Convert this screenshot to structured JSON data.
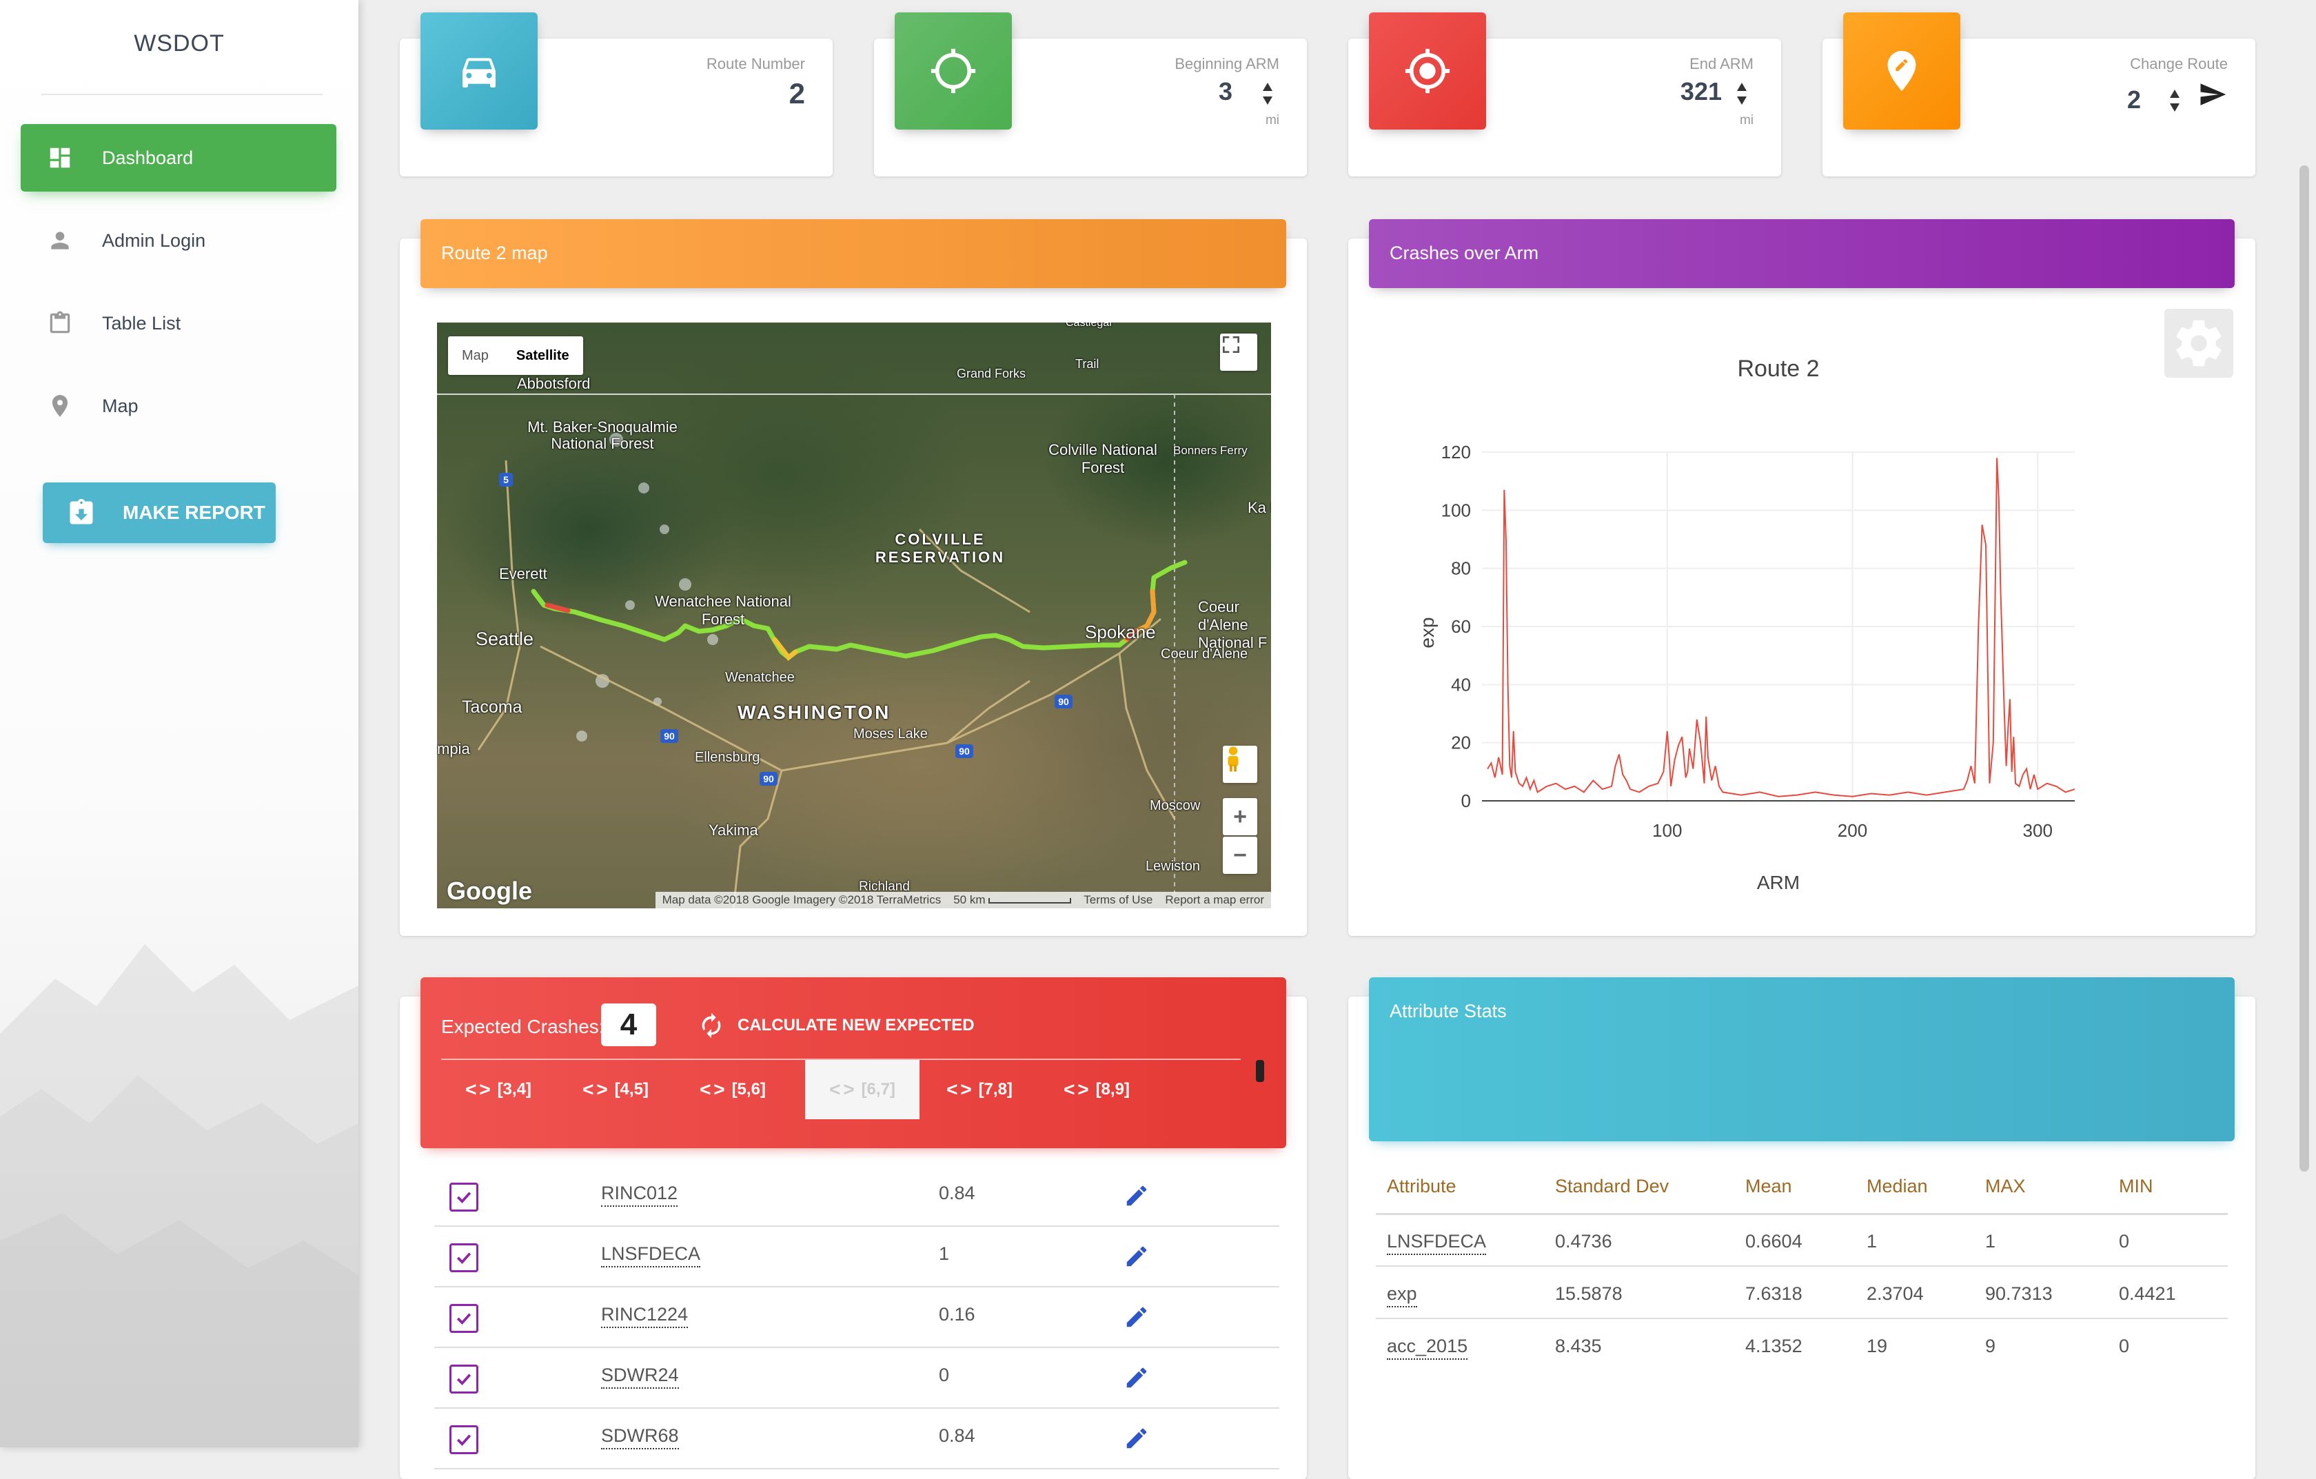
{
  "sidebar": {
    "brand": "WSDOT",
    "items": [
      {
        "label": "Dashboard",
        "icon": "dashboard-icon",
        "active": true
      },
      {
        "label": "Admin Login",
        "icon": "person-icon",
        "active": false
      },
      {
        "label": "Table List",
        "icon": "clipboard-icon",
        "active": false
      },
      {
        "label": "Map",
        "icon": "location-pin-icon",
        "active": false
      }
    ],
    "report_button": "MAKE REPORT"
  },
  "stats": {
    "route": {
      "category": "Route Number",
      "value": "2",
      "color": "#4fb6cd"
    },
    "begin": {
      "category": "Beginning ARM",
      "value": "3",
      "unit": "mi",
      "color": "#5cb85c"
    },
    "end": {
      "category": "End ARM",
      "value": "321",
      "unit": "mi",
      "color": "#e53935"
    },
    "change": {
      "category": "Change Route",
      "value": "2",
      "color": "#f0a33a"
    }
  },
  "map_panel": {
    "title": "Route 2 map",
    "toggle": {
      "map": "Map",
      "satellite": "Satellite"
    },
    "labels": {
      "abbotsford": "Abbotsford",
      "grand_forks": "Grand Forks",
      "trail": "Trail",
      "castlegar": "Castlegar",
      "bonners_ferry": "Bonners Ferry",
      "mt_baker": "Mt. Baker-Snoqualmie National Forest",
      "colville_nf": "Colville National Forest",
      "colville_res": "COLVILLE RESERVATION",
      "everett": "Everett",
      "seattle": "Seattle",
      "tacoma": "Tacoma",
      "wenatchee_nf": "Wenatchee National Forest",
      "wenatchee": "Wenatchee",
      "washington": "WASHINGTON",
      "moses_lake": "Moses Lake",
      "ellensburg": "Ellensburg",
      "yakima": "Yakima",
      "spokane": "Spokane",
      "coeur_nf": "Coeur d'Alene National F",
      "coeur": "Coeur d'Alene",
      "moscow": "Moscow",
      "lewiston": "Lewiston",
      "richland": "Richland",
      "olympia": "mpia",
      "ka_nation": "Ka Nation"
    },
    "highway_shields": [
      "5",
      "90",
      "90",
      "90",
      "90"
    ],
    "google": "Google",
    "attribution": {
      "data": "Map data ©2018 Google Imagery ©2018 TerraMetrics",
      "scale": "50 km",
      "terms": "Terms of Use",
      "report": "Report a map error"
    },
    "zoom_in": "+",
    "zoom_out": "−"
  },
  "chart_panel": {
    "title": "Crashes over Arm"
  },
  "chart_data": {
    "type": "line",
    "title": "Route 2",
    "xlabel": "ARM",
    "ylabel": "exp",
    "xlim": [
      0,
      320
    ],
    "ylim": [
      0,
      120
    ],
    "xticks": [
      100,
      200,
      300
    ],
    "yticks": [
      0,
      20,
      40,
      60,
      80,
      100,
      120
    ],
    "series": [
      {
        "color": "#e8493c",
        "x": [
          3,
          5,
          7,
          9,
          11,
          12,
          13,
          14,
          15,
          16,
          17,
          18,
          20,
          22,
          24,
          26,
          28,
          30,
          35,
          40,
          45,
          50,
          55,
          60,
          65,
          70,
          72,
          74,
          76,
          78,
          80,
          85,
          90,
          95,
          98,
          100,
          101,
          102,
          104,
          106,
          108,
          110,
          111,
          112,
          114,
          116,
          118,
          120,
          121,
          122,
          124,
          126,
          128,
          130,
          140,
          150,
          160,
          170,
          180,
          190,
          200,
          210,
          220,
          230,
          240,
          250,
          260,
          262,
          264,
          266,
          268,
          270,
          272,
          274,
          276,
          278,
          279,
          280,
          282,
          283,
          284,
          285,
          286,
          287,
          288,
          290,
          292,
          294,
          296,
          298,
          300,
          305,
          310,
          315,
          320
        ],
        "y": [
          11,
          13,
          8,
          15,
          9,
          107,
          90,
          40,
          12,
          8,
          24,
          10,
          6,
          5,
          8,
          4,
          7,
          3,
          5,
          6,
          4,
          5,
          3,
          7,
          4,
          5,
          12,
          16,
          9,
          7,
          4,
          3,
          5,
          6,
          10,
          24,
          16,
          5,
          14,
          19,
          22,
          8,
          10,
          18,
          11,
          28,
          20,
          6,
          29,
          15,
          7,
          12,
          5,
          3,
          2,
          3,
          1.5,
          2,
          3,
          2,
          1.5,
          2.5,
          2,
          3,
          2,
          3,
          4,
          7,
          12,
          6,
          60,
          95,
          88,
          6,
          20,
          118,
          104,
          72,
          30,
          12,
          25,
          35,
          10,
          22,
          6,
          5,
          9,
          11,
          4,
          9,
          4,
          6,
          5,
          3,
          4
        ]
      }
    ]
  },
  "expected": {
    "label": "Expected Crashes:",
    "value": "4",
    "calc_button": "CALCULATE NEW EXPECTED",
    "tabs": [
      "[3,4]",
      "[4,5]",
      "[5,6]",
      "[6,7]",
      "[7,8]",
      "[8,9]"
    ],
    "rows": [
      {
        "name": "RINC012",
        "value": "0.84"
      },
      {
        "name": "LNSFDECA",
        "value": "1"
      },
      {
        "name": "RINC1224",
        "value": "0.16"
      },
      {
        "name": "SDWR24",
        "value": "0"
      },
      {
        "name": "SDWR68",
        "value": "0.84"
      }
    ]
  },
  "attribute_stats": {
    "title": "Attribute Stats",
    "headers": [
      "Attribute",
      "Standard Dev",
      "Mean",
      "Median",
      "MAX",
      "MIN"
    ],
    "rows": [
      [
        "LNSFDECA",
        "0.4736",
        "0.6604",
        "1",
        "1",
        "0"
      ],
      [
        "exp",
        "15.5878",
        "7.6318",
        "2.3704",
        "90.7313",
        "0.4421"
      ],
      [
        "acc_2015",
        "8.435",
        "4.1352",
        "19",
        "9",
        "0"
      ]
    ]
  }
}
